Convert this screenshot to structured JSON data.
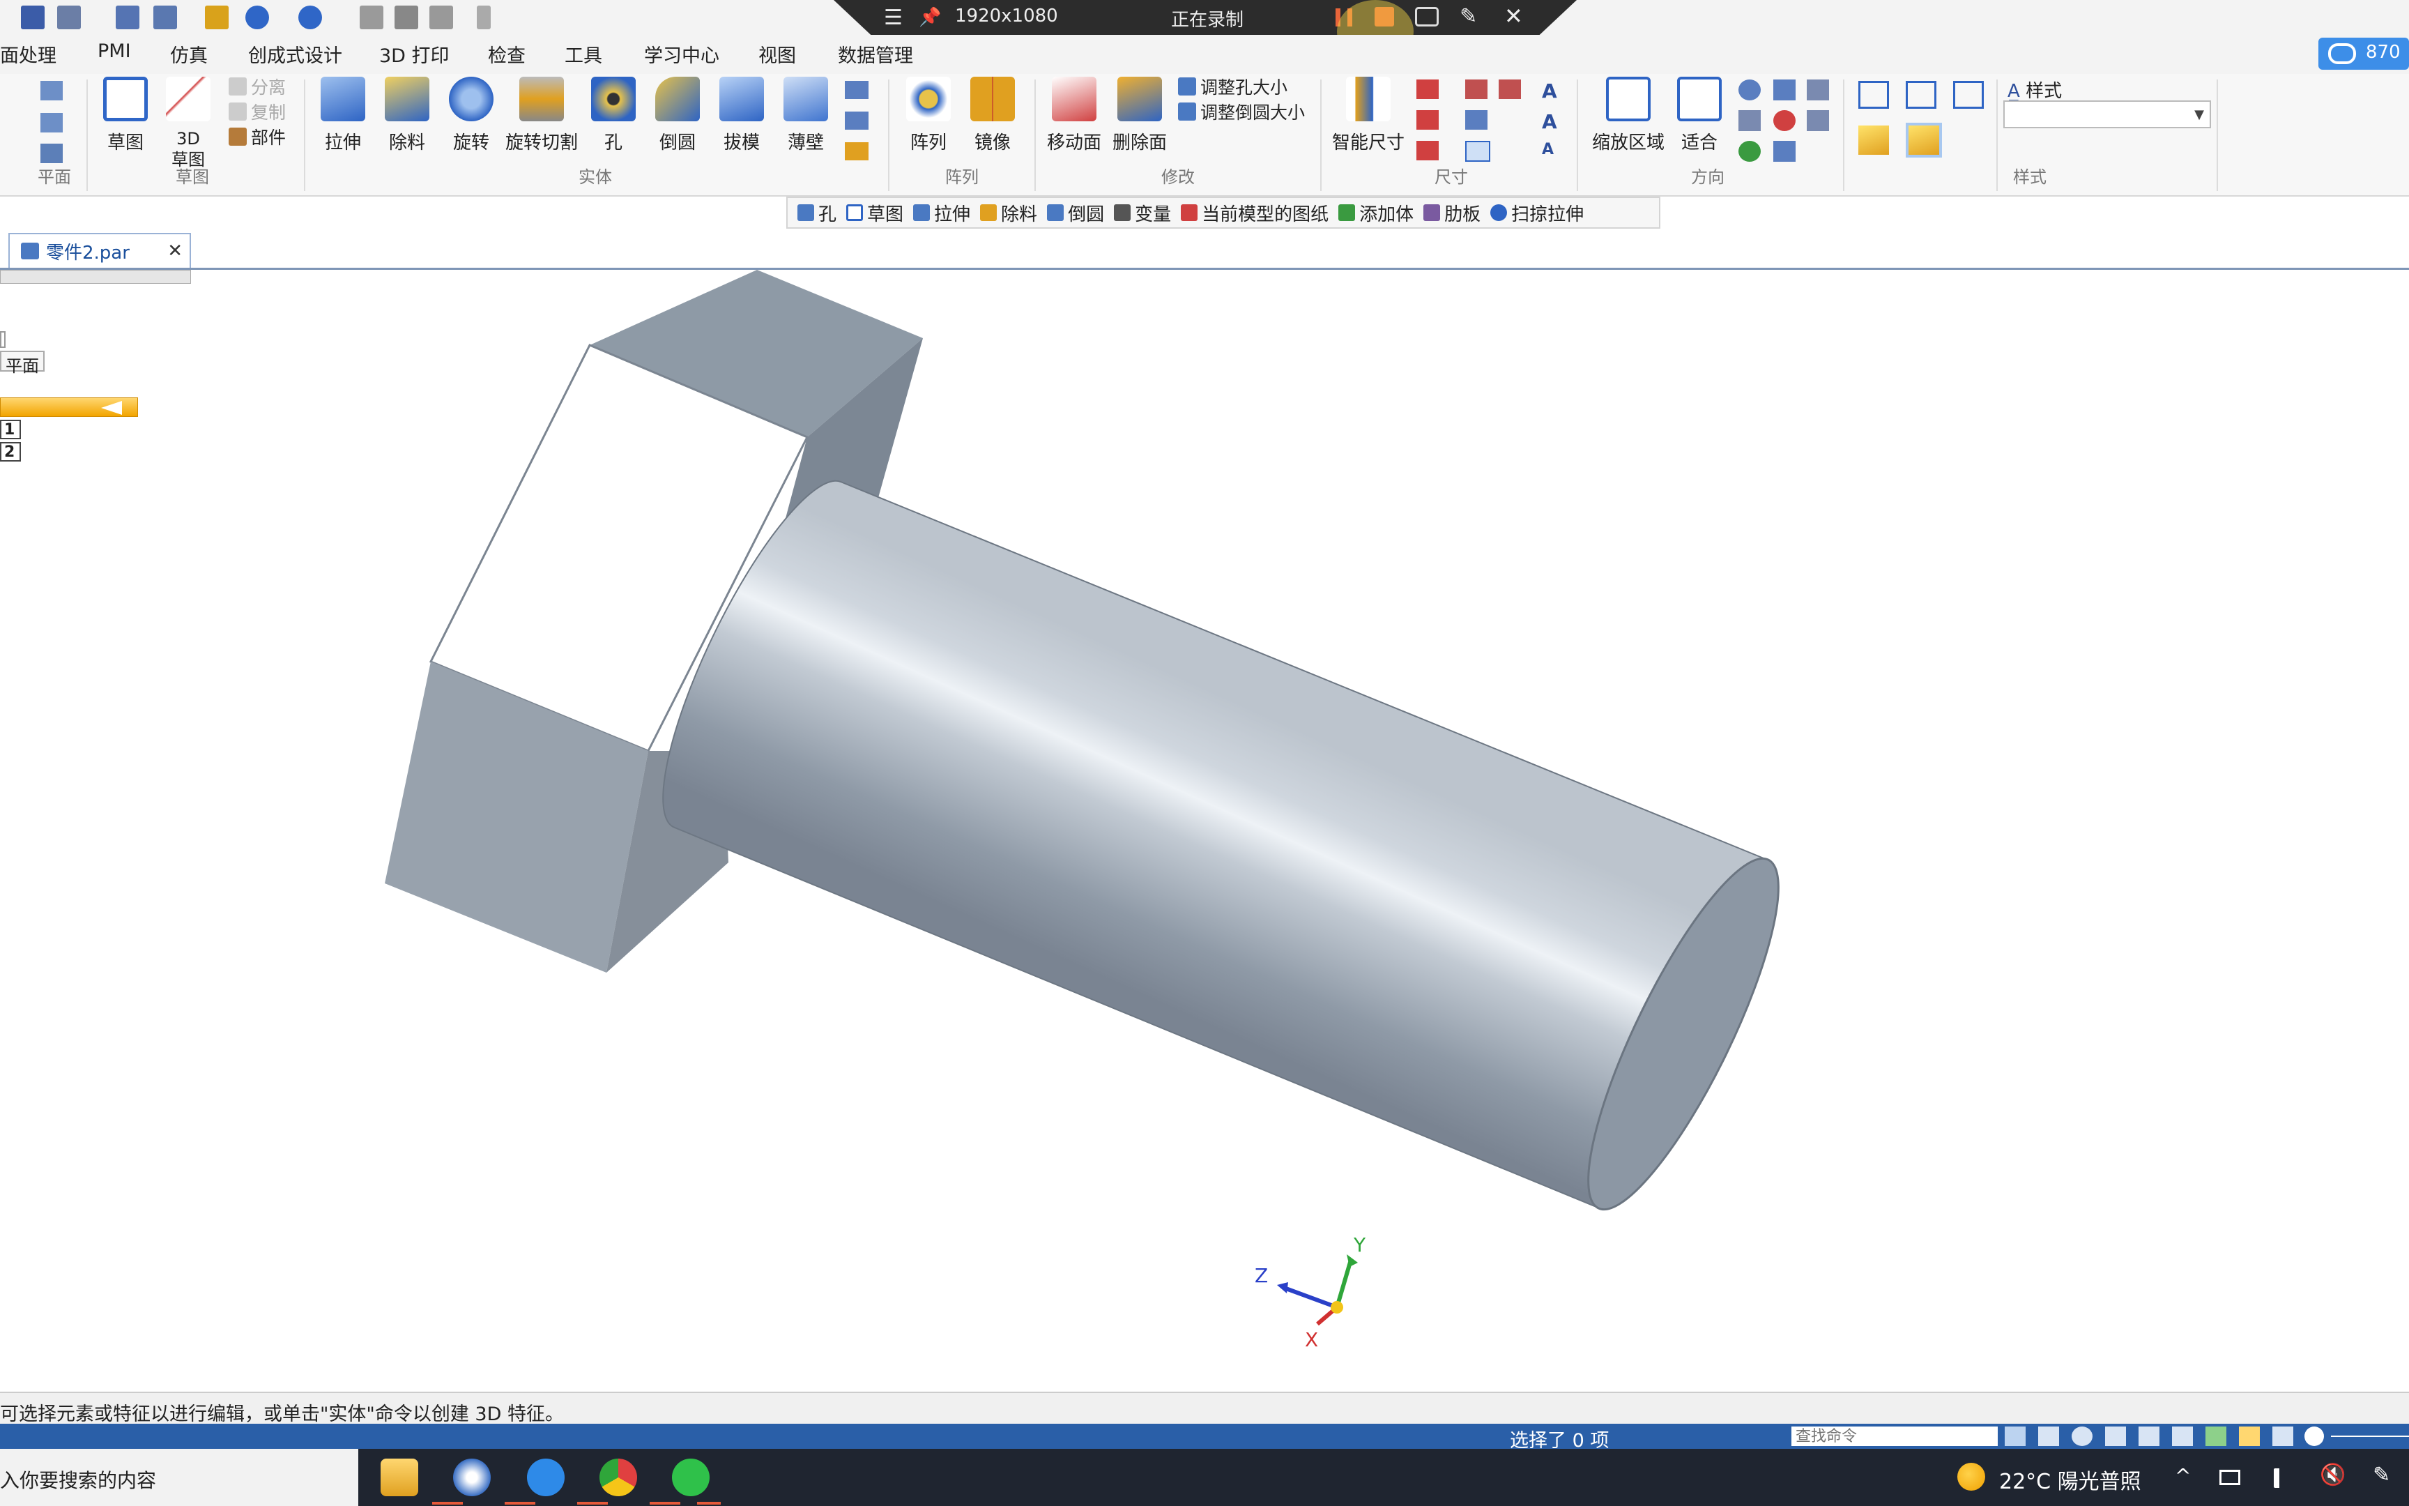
{
  "recorder": {
    "resolution": "1920x1080",
    "status": "正在录制"
  },
  "menu": [
    "面处理",
    "PMI",
    "仿真",
    "创成式设计",
    "3D 打印",
    "检查",
    "工具",
    "学习中心",
    "视图",
    "数据管理"
  ],
  "ribbon": {
    "plane_group": "平面",
    "sketch_btn": "草图",
    "sketch3d_btn": "3D\n草图",
    "sketch_group": "草图",
    "sketch_small": [
      "分离",
      "复制",
      "部件"
    ],
    "solid": [
      "拉伸",
      "除料",
      "旋转",
      "旋转切割",
      "孔",
      "倒圆",
      "拔模",
      "薄壁"
    ],
    "solid_group": "实体",
    "pattern": [
      "阵列",
      "镜像"
    ],
    "pattern_group": "阵列",
    "modify": [
      "移动面",
      "删除面"
    ],
    "modify_small": [
      "调整孔大小",
      "调整倒圆大小"
    ],
    "modify_group": "修改",
    "dim_btn": "智能尺寸",
    "dim_group": "尺寸",
    "orient": [
      "缩放区域",
      "适合"
    ],
    "orient_group": "方向",
    "style_label": "样式",
    "style_group": "样式"
  },
  "cloud_badge": "870",
  "command_bar": [
    "孔",
    "草图",
    "拉伸",
    "除料",
    "倒圆",
    "变量",
    "当前模型的图纸",
    "添加体",
    "肋板",
    "扫掠拉伸"
  ],
  "doc_tab": "零件2.par",
  "left_panel": {
    "plane": "平面",
    "rows": [
      "1",
      "2"
    ]
  },
  "axes": {
    "x": "X",
    "y": "Y",
    "z": "Z"
  },
  "prompt": "可选择元素或特征以进行编辑，或单击\"实体\"命令以创建 3D 特征。",
  "status": {
    "selection": "选择了 0 项",
    "search_placeholder": "查找命令"
  },
  "taskbar": {
    "search": "入你要搜索的内容",
    "weather": "22°C 陽光普照"
  }
}
